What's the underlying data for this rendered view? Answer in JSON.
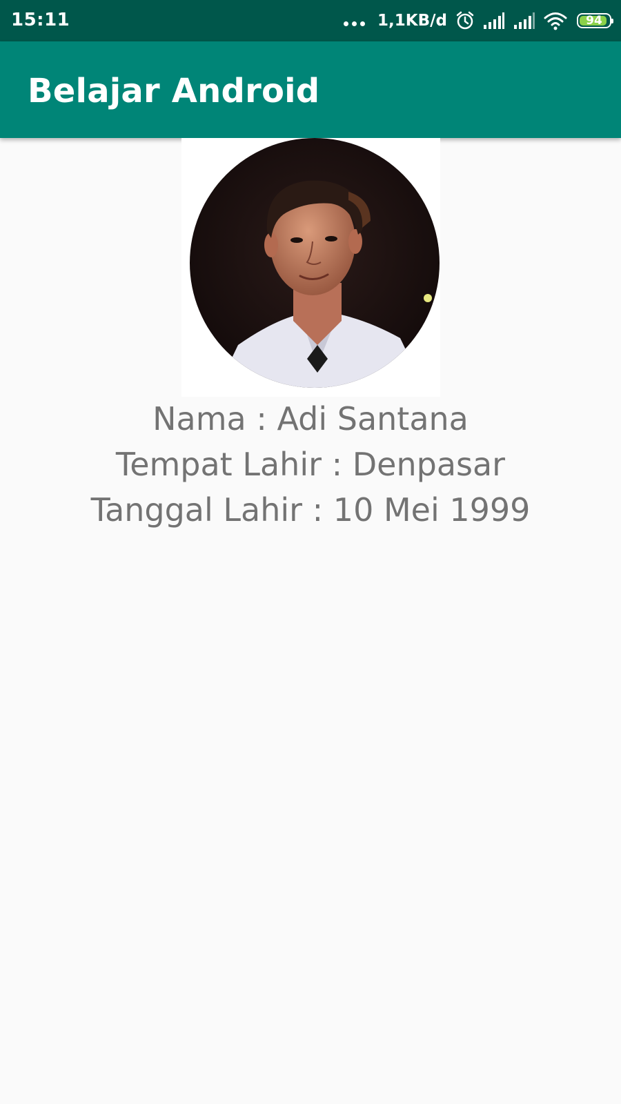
{
  "status_bar": {
    "time": "15:11",
    "network_speed": "1,1KB/d",
    "battery_level": "94",
    "battery_fraction": 0.94,
    "icons": [
      "more-dots-icon",
      "alarm-icon",
      "signal-icon",
      "signal-icon",
      "wifi-icon",
      "battery-icon"
    ]
  },
  "app_bar": {
    "title": "Belajar Android"
  },
  "profile": {
    "photo_icon": "profile-photo",
    "name_line": "Nama : Adi Santana",
    "birthplace_line": "Tempat Lahir : Denpasar",
    "birthdate_line": "Tanggal Lahir : 10 Mei 1999"
  },
  "colors": {
    "status_bar": "#00574b",
    "app_bar": "#008577",
    "background": "#fafafa",
    "text": "#737373",
    "battery": "#8bd14a"
  }
}
